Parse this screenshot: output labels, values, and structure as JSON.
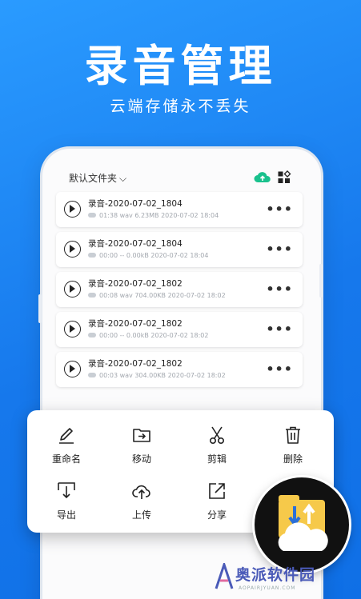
{
  "hero": {
    "title": "录音管理",
    "subtitle": "云端存储永不丢失"
  },
  "toolbar": {
    "folder_label": "默认文件夹",
    "folder_chevron": "⌵",
    "cloud_icon": "cloud-upload-icon",
    "grid_icon": "grid-icon",
    "accent_color": "#19c18d"
  },
  "recordings": [
    {
      "name": "录音-2020-07-02_1804",
      "meta": "01:38  wav  6.23MB  2020-07-02 18:04",
      "more": "•••"
    },
    {
      "name": "录音-2020-07-02_1804",
      "meta": "00:00  --  0.00kB  2020-07-02 18:04",
      "more": "•••"
    },
    {
      "name": "录音-2020-07-02_1802",
      "meta": "00:08  wav  704.00KB  2020-07-02 18:02",
      "more": "•••"
    },
    {
      "name": "录音-2020-07-02_1802",
      "meta": "00:00  --  0.00kB  2020-07-02 18:02",
      "more": "•••"
    },
    {
      "name": "录音-2020-07-02_1802",
      "meta": "00:03  wav  304.00KB  2020-07-02 18:02",
      "more": "•••"
    }
  ],
  "actions": [
    {
      "label": "重命名",
      "icon": "pencil-icon"
    },
    {
      "label": "移动",
      "icon": "folder-move-icon"
    },
    {
      "label": "剪辑",
      "icon": "scissors-icon"
    },
    {
      "label": "删除",
      "icon": "trash-icon"
    },
    {
      "label": "导出",
      "icon": "export-icon"
    },
    {
      "label": "上传",
      "icon": "cloud-upload-icon"
    },
    {
      "label": "分享",
      "icon": "share-icon"
    }
  ],
  "watermark": {
    "text": "奥派软件园",
    "sub": "AOPAIRJYUAN.COM"
  },
  "colors": {
    "background": "#1678ec",
    "badge_folder": "#f6c94a",
    "badge_bg": "#111111"
  }
}
